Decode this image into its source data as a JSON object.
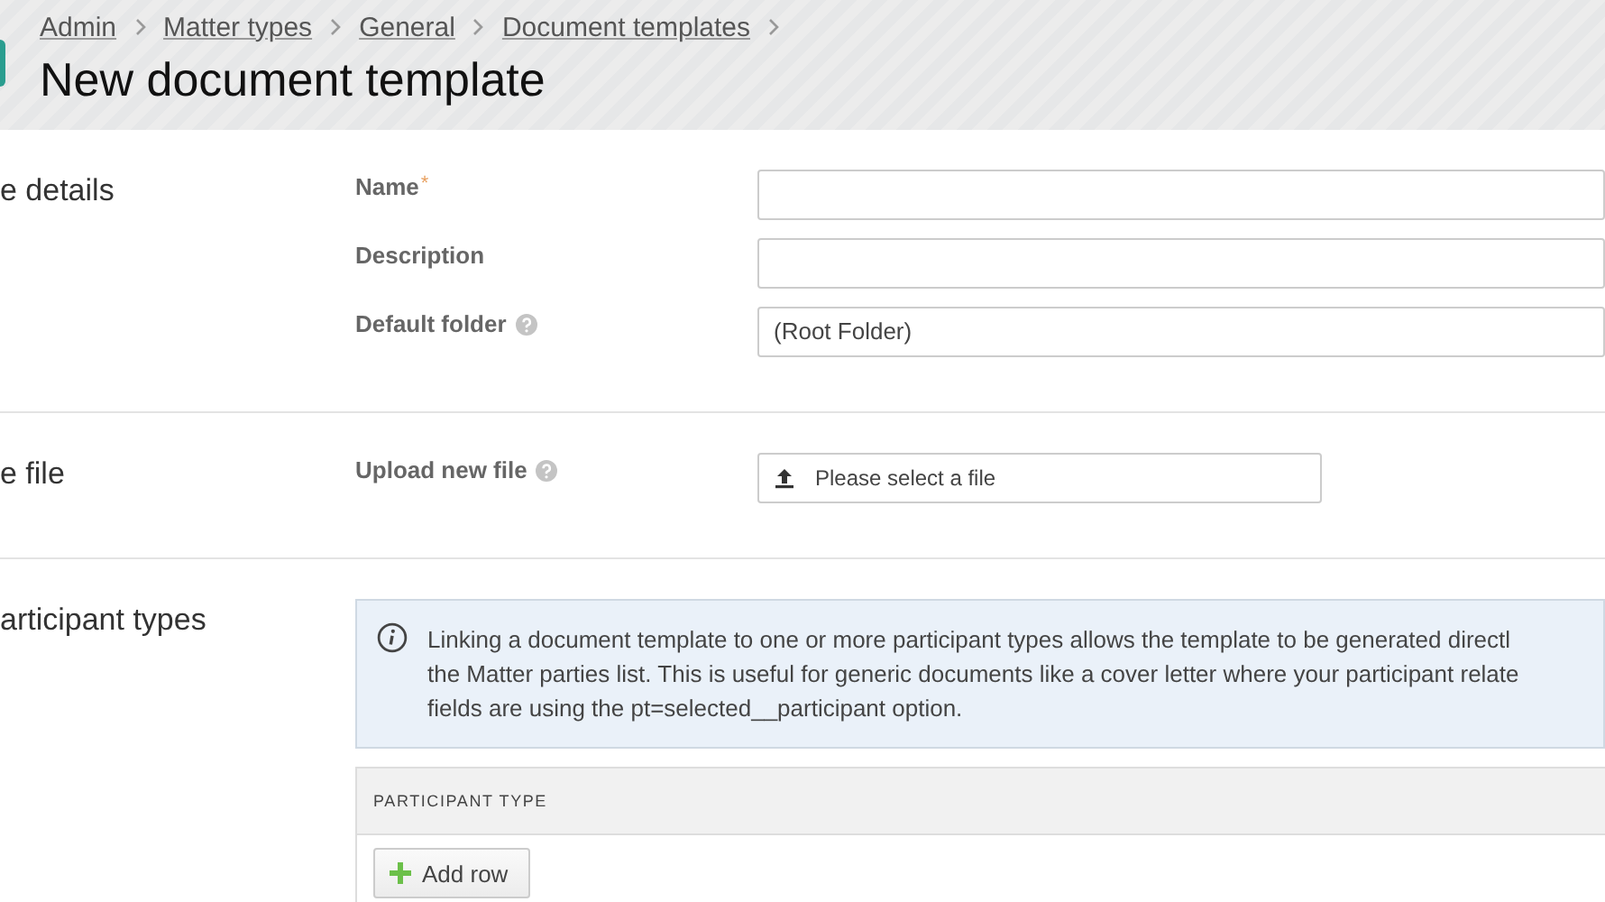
{
  "breadcrumbs": [
    "Admin",
    "Matter types",
    "General",
    "Document templates"
  ],
  "title": "New document template",
  "sections": [
    {
      "heading": "e details",
      "fields": [
        {
          "kind": "text",
          "label": "Name",
          "required_mark": "*",
          "help": false
        },
        {
          "kind": "text",
          "label": "Description",
          "help": false
        },
        {
          "kind": "select",
          "label": "Default folder",
          "help": true,
          "value": "(Root Folder)"
        }
      ]
    },
    {
      "heading": "e file",
      "fields": [
        {
          "kind": "file",
          "label": "Upload new file",
          "help": true,
          "placeholder": "Please select a file"
        }
      ]
    },
    {
      "heading": "articipant types",
      "info": [
        "Linking a document template to one or more participant types allows the template to be generated directl",
        "the Matter parties list. This is useful for generic documents like a cover letter where your participant relate",
        "fields are using the pt=selected__participant option."
      ],
      "table": {
        "columns": [
          "PARTICIPANT TYPE"
        ],
        "add_button": "Add row"
      }
    }
  ]
}
